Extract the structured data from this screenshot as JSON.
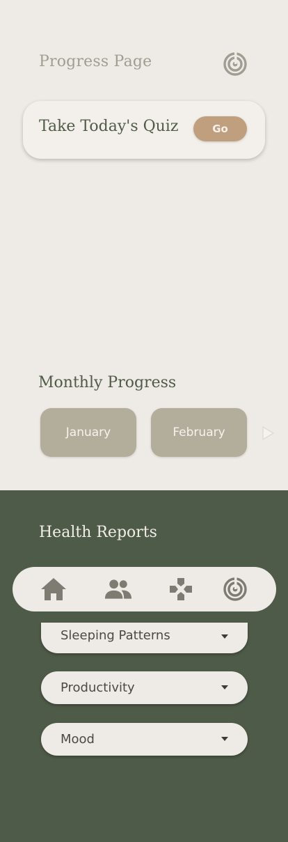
{
  "header": {
    "title": "Progress Page",
    "icon": "target-progress-icon"
  },
  "quiz": {
    "label": "Take Today's Quiz",
    "button_label": "Go"
  },
  "monthly": {
    "title": "Monthly Progress",
    "months": [
      "January",
      "February"
    ],
    "next_icon": "next-arrow-icon"
  },
  "health": {
    "title": "Health Reports",
    "dropdowns": [
      {
        "label": "Sleeping Patterns"
      },
      {
        "label": "Productivity"
      },
      {
        "label": "Mood"
      }
    ]
  },
  "nav": {
    "items": [
      {
        "icon": "home-icon"
      },
      {
        "icon": "people-icon"
      },
      {
        "icon": "gamepad-icon"
      },
      {
        "icon": "target-progress-icon"
      }
    ]
  },
  "colors": {
    "background": "#eeeae5",
    "dark_green": "#4f5b49",
    "accent_tan": "#bf9f7e",
    "month_button": "#b3ad9c",
    "icon_grey": "#a19d92"
  }
}
